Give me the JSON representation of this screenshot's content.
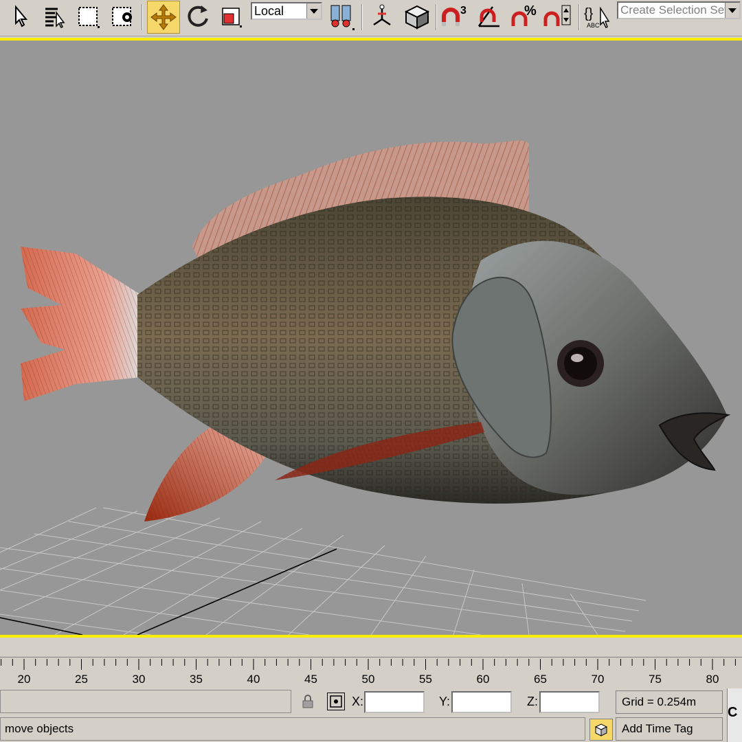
{
  "toolbar": {
    "coord_system": "Local",
    "selection_set_placeholder": "Create Selection Set",
    "snap_angle_number": "3"
  },
  "timeline": {
    "tick_labels": [
      "20",
      "25",
      "30",
      "35",
      "40",
      "45",
      "50",
      "55",
      "60",
      "65",
      "70",
      "75",
      "80"
    ]
  },
  "status_bar": {
    "x_label": "X:",
    "y_label": "Y:",
    "z_label": "Z:",
    "grid_text": "Grid = 0.254m",
    "prompt_text": "move objects",
    "add_time_tag": "Add Time Tag",
    "right_edge_letter": "C"
  },
  "colors": {
    "viewport_bg": "#979797",
    "active_tool": "#f6d86a",
    "viewport_border": "#ffee00"
  }
}
